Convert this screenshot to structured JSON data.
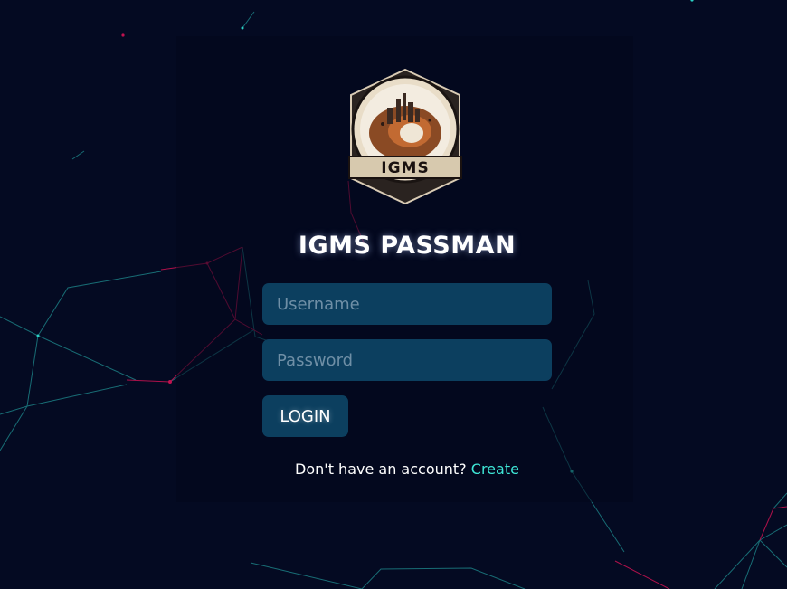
{
  "app": {
    "logo_text": "IGMS",
    "title": "IGMS PASSMAN"
  },
  "form": {
    "username_placeholder": "Username",
    "password_placeholder": "Password",
    "login_label": "LOGIN"
  },
  "signup": {
    "prompt": "Don't have an account?",
    "link_label": "Create"
  },
  "colors": {
    "background": "#040a22",
    "input_bg": "#0c3f5f",
    "link": "#3ee6d6",
    "network_cyan": "#1f8f8f",
    "network_pink": "#c0124f"
  }
}
